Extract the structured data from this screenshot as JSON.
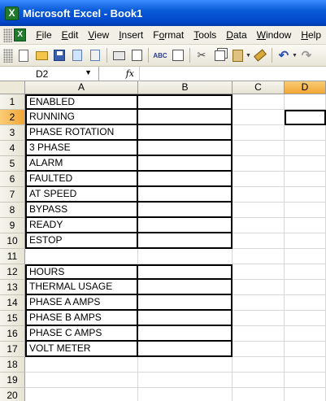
{
  "window": {
    "title": "Microsoft Excel - Book1"
  },
  "menu": [
    {
      "pre": "",
      "u": "F",
      "post": "ile"
    },
    {
      "pre": "",
      "u": "E",
      "post": "dit"
    },
    {
      "pre": "",
      "u": "V",
      "post": "iew"
    },
    {
      "pre": "",
      "u": "I",
      "post": "nsert"
    },
    {
      "pre": "F",
      "u": "o",
      "post": "rmat"
    },
    {
      "pre": "",
      "u": "T",
      "post": "ools"
    },
    {
      "pre": "",
      "u": "D",
      "post": "ata"
    },
    {
      "pre": "",
      "u": "W",
      "post": "indow"
    },
    {
      "pre": "",
      "u": "H",
      "post": "elp"
    }
  ],
  "formula_bar": {
    "name_box": "D2",
    "fx": "fx",
    "formula": ""
  },
  "columns": [
    "A",
    "B",
    "C",
    "D"
  ],
  "active_cell": {
    "col": "D",
    "row": 2
  },
  "rows": [
    {
      "n": "1",
      "a": "ENABLED"
    },
    {
      "n": "2",
      "a": "RUNNING"
    },
    {
      "n": "3",
      "a": "PHASE ROTATION"
    },
    {
      "n": "4",
      "a": "3 PHASE"
    },
    {
      "n": "5",
      "a": "ALARM"
    },
    {
      "n": "6",
      "a": "FAULTED"
    },
    {
      "n": "7",
      "a": "AT SPEED"
    },
    {
      "n": "8",
      "a": "BYPASS"
    },
    {
      "n": "9",
      "a": "READY"
    },
    {
      "n": "10",
      "a": "ESTOP"
    },
    {
      "n": "11",
      "a": ""
    },
    {
      "n": "12",
      "a": "HOURS"
    },
    {
      "n": "13",
      "a": "THERMAL USAGE"
    },
    {
      "n": "14",
      "a": "PHASE A AMPS"
    },
    {
      "n": "15",
      "a": "PHASE B AMPS"
    },
    {
      "n": "16",
      "a": "PHASE C AMPS"
    },
    {
      "n": "17",
      "a": "VOLT METER"
    },
    {
      "n": "18",
      "a": ""
    },
    {
      "n": "19",
      "a": ""
    },
    {
      "n": "20",
      "a": ""
    }
  ]
}
